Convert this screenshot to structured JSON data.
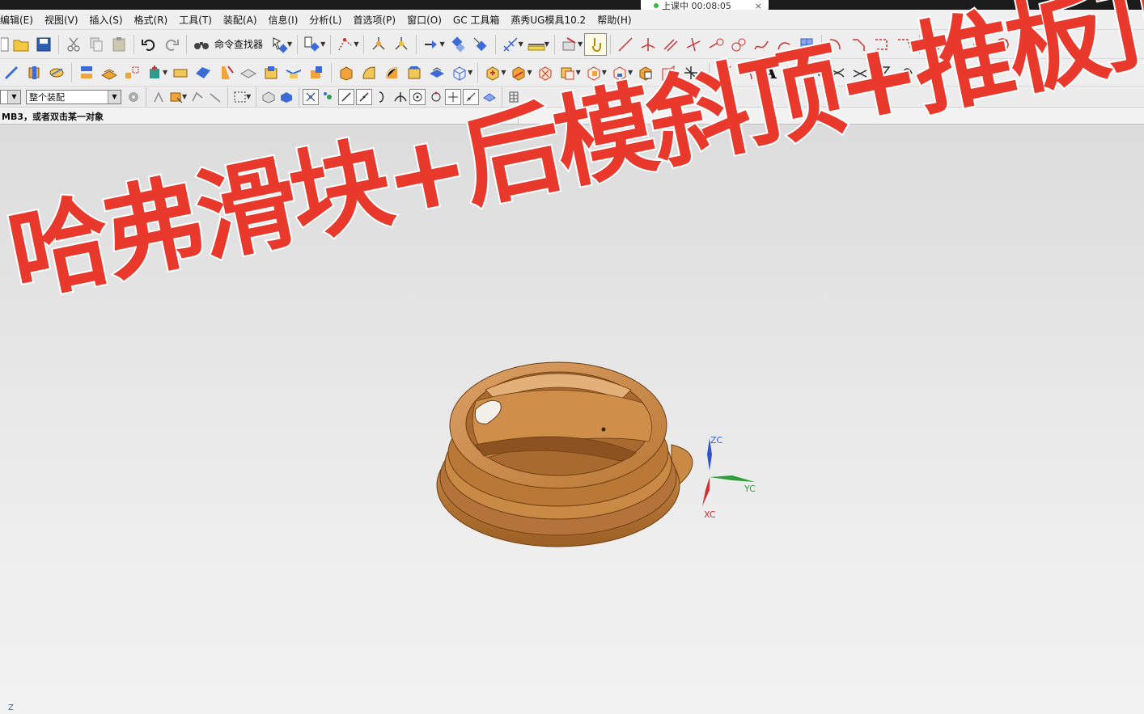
{
  "window": {
    "timer_label": "上课中 00:08:05",
    "timer_close": "×"
  },
  "menu": {
    "items": [
      {
        "label": "编辑(E)"
      },
      {
        "label": "视图(V)"
      },
      {
        "label": "插入(S)"
      },
      {
        "label": "格式(R)"
      },
      {
        "label": "工具(T)"
      },
      {
        "label": "装配(A)"
      },
      {
        "label": "信息(I)"
      },
      {
        "label": "分析(L)"
      },
      {
        "label": "首选项(P)"
      },
      {
        "label": "窗口(O)"
      },
      {
        "label": "GC 工具箱"
      },
      {
        "label": "燕秀UG模具10.2"
      },
      {
        "label": "帮助(H)"
      }
    ]
  },
  "toolbar": {
    "command_finder_label": "命令查找器",
    "assembly_filter_value": "整个装配",
    "text_tool_glyph": "A"
  },
  "cue_line": {
    "text": "MB3，或者双击某一对象"
  },
  "overlay": {
    "title": "哈弗滑块+后模斜顶+推板顶出"
  },
  "triad": {
    "zc": "ZC",
    "yc": "YC",
    "xc": "XC"
  },
  "viewport": {
    "corner_axis_label": "Z"
  },
  "colors": {
    "overlay_text": "#e8392c",
    "part_body": "#c98a45",
    "background": "#e2e2e2"
  }
}
